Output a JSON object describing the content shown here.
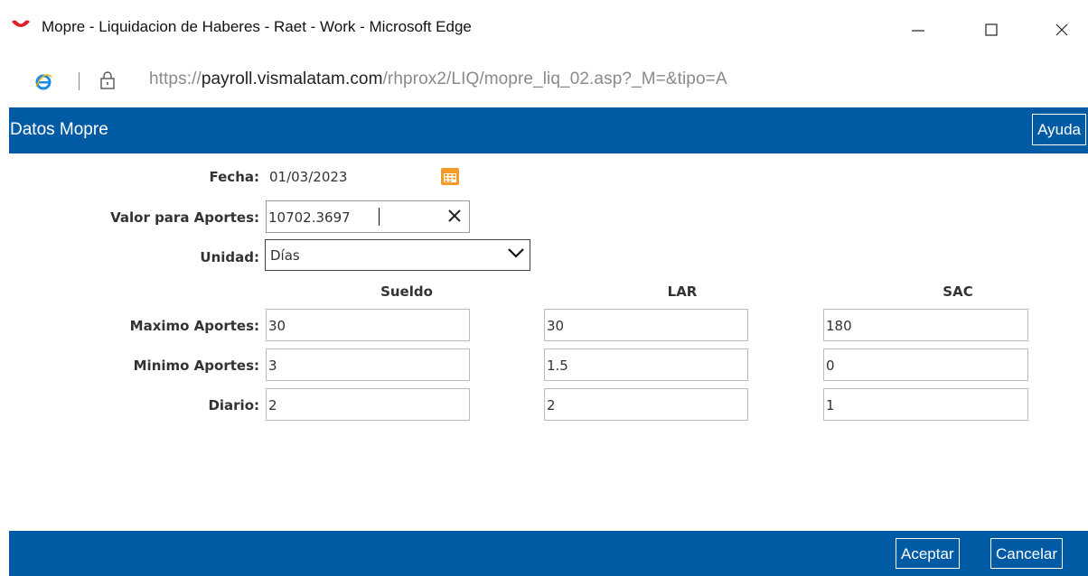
{
  "window": {
    "title": "Mopre - Liquidacion de Haberes - Raet - Work - Microsoft Edge"
  },
  "addressbar": {
    "url_scheme": "https://",
    "url_host": "payroll.vismalatam.com",
    "url_path": "/rhprox2/LIQ/mopre_liq_02.asp?_M=&tipo=A"
  },
  "header": {
    "title": "Datos Mopre",
    "help_label": "Ayuda"
  },
  "form": {
    "fecha": {
      "label": "Fecha:",
      "value": "01/03/2023"
    },
    "valor": {
      "label": "Valor para Aportes:",
      "value": "10702.3697"
    },
    "unidad": {
      "label": "Unidad:",
      "selected": "Días"
    },
    "columns": [
      "Sueldo",
      "LAR",
      "SAC"
    ],
    "rows": [
      {
        "label": "Maximo Aportes:",
        "values": [
          "30",
          "30",
          "180"
        ]
      },
      {
        "label": "Minimo Aportes:",
        "values": [
          "3",
          "1.5",
          "0"
        ]
      },
      {
        "label": "Diario:",
        "values": [
          "2",
          "2",
          "1"
        ]
      }
    ]
  },
  "footer": {
    "accept_label": "Aceptar",
    "cancel_label": "Cancelar"
  },
  "colors": {
    "header_blue": "#005ba4",
    "calendar_orange": "#f39a2b"
  },
  "icons": [
    "app-logo-icon",
    "minimize-icon",
    "maximize-icon",
    "close-icon",
    "ie-icon",
    "lock-icon",
    "calendar-icon",
    "clear-icon",
    "chevron-down-icon"
  ]
}
